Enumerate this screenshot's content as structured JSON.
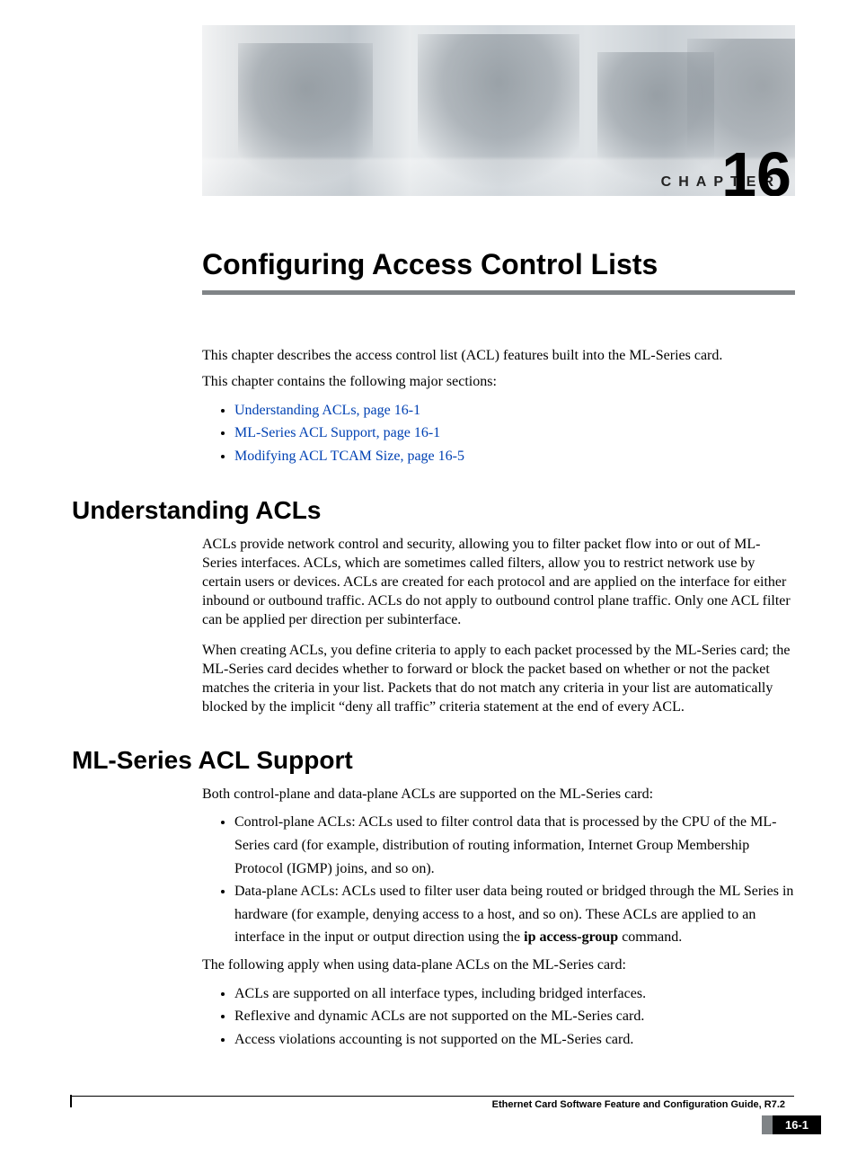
{
  "header": {
    "chapter_label": "CHAPTER",
    "chapter_number": "16"
  },
  "title": "Configuring Access Control Lists",
  "intro": {
    "p1": "This chapter describes the access control list (ACL) features built into the ML-Series card.",
    "p2": "This chapter contains the following major sections:",
    "toc": [
      "Understanding ACLs, page 16-1",
      "ML-Series ACL Support, page 16-1",
      "Modifying ACL TCAM Size, page 16-5"
    ]
  },
  "section1": {
    "heading": "Understanding ACLs",
    "p1": "ACLs provide network control and security, allowing you to filter packet flow into or out of ML-Series interfaces. ACLs, which are sometimes called filters, allow you to restrict network use by certain users or devices. ACLs are created for each protocol and are applied on the interface for either inbound or outbound traffic. ACLs do not apply to outbound control plane traffic. Only one ACL filter can be applied per direction per subinterface.",
    "p2": "When creating ACLs, you define criteria to apply to each packet processed by the ML-Series card; the ML-Series card decides whether to forward or block the packet based on whether or not the packet matches the criteria in your list. Packets that do not match any criteria in your list are automatically blocked by the implicit “deny all traffic” criteria statement at the end of every ACL."
  },
  "section2": {
    "heading": "ML-Series ACL Support",
    "p1": "Both control-plane and data-plane ACLs are supported on the ML-Series card:",
    "plane_bullets": {
      "b0": "Control-plane ACLs: ACLs used to filter control data that is processed by the CPU of the ML-Series card (for example, distribution of routing information, Internet Group Membership Protocol (IGMP) joins, and so on).",
      "b1_pre": "Data-plane ACLs: ACLs used to filter user data being routed or bridged through the ML Series in hardware (for example, denying access to a host, and so on). These ACLs are applied to an interface in the input or output direction using the ",
      "b1_cmd": "ip access-group",
      "b1_post": " command."
    },
    "p2": "The following apply when using data-plane ACLs on the ML-Series card:",
    "apply_bullets": [
      "ACLs are supported on all interface types, including bridged interfaces.",
      "Reflexive and dynamic ACLs are not supported on the ML-Series card.",
      "Access violations accounting is not supported on the ML-Series card."
    ]
  },
  "footer": {
    "guide_title": "Ethernet Card Software Feature and Configuration Guide, R7.2",
    "page_number": "16-1"
  }
}
